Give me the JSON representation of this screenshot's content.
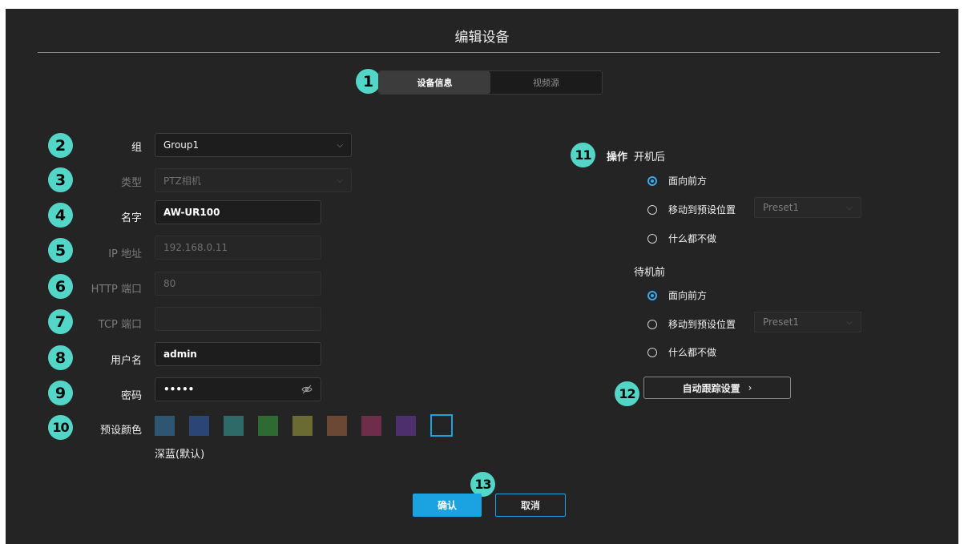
{
  "dialog": {
    "title": "编辑设备"
  },
  "tabs": [
    {
      "label": "设备信息"
    },
    {
      "label": "视频源"
    }
  ],
  "badges": [
    "1",
    "2",
    "3",
    "4",
    "5",
    "6",
    "7",
    "8",
    "9",
    "10",
    "11",
    "12",
    "13"
  ],
  "form": {
    "group": {
      "label": "组",
      "value": "Group1"
    },
    "type": {
      "label": "类型",
      "value": "PTZ相机"
    },
    "name": {
      "label": "名字",
      "value": "AW-UR100"
    },
    "ip": {
      "label": "IP 地址",
      "value": "192.168.0.11"
    },
    "http": {
      "label": "HTTP 端口",
      "value": "80"
    },
    "tcp": {
      "label": "TCP 端口",
      "value": ""
    },
    "username": {
      "label": "用户名",
      "value": "admin"
    },
    "password": {
      "label": "密码",
      "value": "•••••"
    },
    "preset_color": {
      "label": "预设颜色",
      "colors": [
        "#2e5673",
        "#2b4576",
        "#2e6a68",
        "#2e6b33",
        "#6a6a33",
        "#6b4833",
        "#6e2d48",
        "#4d2f6e",
        "#242424"
      ],
      "selected_index": 8,
      "selected_name": "深蓝(默认)"
    }
  },
  "operation": {
    "label": "操作",
    "after_boot": {
      "title": "开机后",
      "options": [
        "面向前方",
        "移动到预设位置",
        "什么都不做"
      ],
      "selected_index": 0,
      "preset_value": "Preset1"
    },
    "before_standby": {
      "title": "待机前",
      "options": [
        "面向前方",
        "移动到预设位置",
        "什么都不做"
      ],
      "selected_index": 0,
      "preset_value": "Preset1"
    },
    "auto_tracking_button": "自动跟踪设置",
    "chevron_right": "›"
  },
  "footer": {
    "confirm": "确认",
    "cancel": "取消"
  },
  "icons": {
    "chevron_down": "⌵",
    "eye_off": "eye-off-icon"
  },
  "colors": {
    "accent": "#1aa3e0",
    "badge": "#53d5c7",
    "background": "#242424"
  }
}
